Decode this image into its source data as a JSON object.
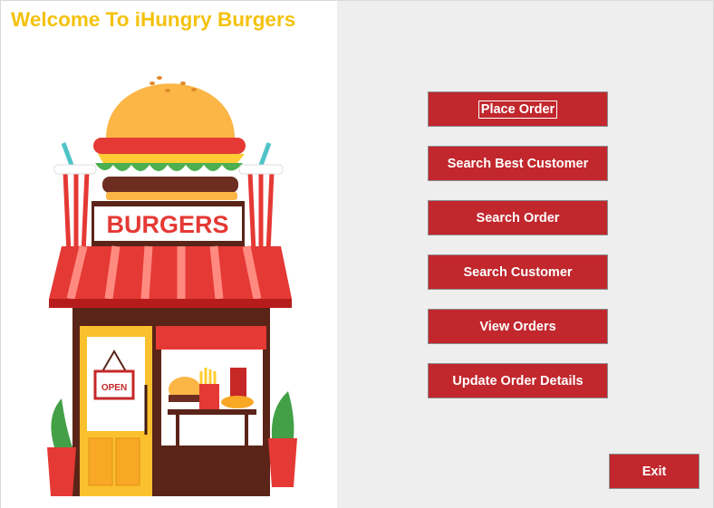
{
  "window": {
    "title": "Welcome To iHungry Burgers"
  },
  "illustration": {
    "sign_text": "BURGERS",
    "door_sign": "OPEN"
  },
  "menu": {
    "buttons": [
      {
        "id": "place-order",
        "label": "Place Order"
      },
      {
        "id": "search-best-customer",
        "label": "Search Best Customer"
      },
      {
        "id": "search-order",
        "label": "Search Order"
      },
      {
        "id": "search-customer",
        "label": "Search Customer"
      },
      {
        "id": "view-orders",
        "label": "View Orders"
      },
      {
        "id": "update-order-details",
        "label": "Update Order Details"
      }
    ],
    "exit_label": "Exit"
  },
  "colors": {
    "title": "#f4c20d",
    "button": "#c1272d",
    "panel_bg": "#eeeeee"
  }
}
